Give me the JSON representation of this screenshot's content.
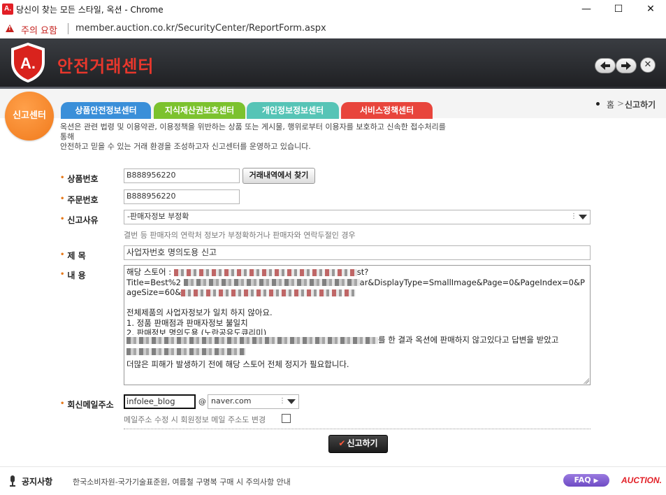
{
  "window": {
    "title": "당신이 찾는 모든 스타일, 옥션 - Chrome",
    "minimize": "—",
    "maximize": "☐",
    "close": "✕"
  },
  "address_bar": {
    "warning": "주의 요함",
    "url": "member.auction.co.kr/SecurityCenter/ReportForm.aspx"
  },
  "header": {
    "logo_text": "A.",
    "title": "안전거래센터",
    "close_label": "✕"
  },
  "badge": "신고센터",
  "tabs": [
    {
      "label": "상품안전정보센터",
      "color": "#3a8fd9"
    },
    {
      "label": "지식재산권보호센터",
      "color": "#7cc22e"
    },
    {
      "label": "개인정보정보센터",
      "color": "#56c4b6"
    },
    {
      "label": "서비스정책센터",
      "color": "#e8453c"
    }
  ],
  "breadcrumb": {
    "home": "홈",
    "sep": ">",
    "current": "신고하기"
  },
  "intro": {
    "line1": "옥션은 관련 법령 및 이용약관, 이용정책을 위반하는 상품 또는 게시물, 행위로부터 이용자를 보호하고 신속한 접수처리를 통해",
    "line2": "안전하고 믿을 수 있는 거래 환경을 조성하고자 신고센터를 운영하고 있습니다."
  },
  "form": {
    "product_no_label": "상품번호",
    "product_no_value": "B888956220",
    "find_button": "거래내역에서 찾기",
    "order_no_label": "주문번호",
    "order_no_value": "B888956220",
    "reason_label": "신고사유",
    "reason_value": "-판매자정보 부정확",
    "reason_help": "결번 등 판매자의 연락처 정보가 부정확하거나 판매자와 연락두절인 경우",
    "subject_label": "제    목",
    "subject_value": "사업자번호 명의도용 신고",
    "content_label": "내    용",
    "content": {
      "l1_start": "해당 스토어 :",
      "l1_end": "st?",
      "l2_start": "Title=Best%2",
      "l2_end": "ar&DisplayType=SmallImage&Page=0&PageIndex=0&P",
      "l3_start": "ageSize=60&",
      "l5": "전체제품의 사업자정보가 일치 하지 않아요.",
      "l6": "1. 정품 판매점과 판매자정보 불일치",
      "l7": "2. 판매정보 명의도용 (노란공유도큐리미)",
      "l8_end": "를 한 결과 옥션에 판매하지 않고있다고 답변을 받았고",
      "l10": "더많은 피해가 발생하기 전에 해당 스토어 전체 정지가 필요합니다."
    },
    "email_label": "회신메일주소",
    "email_user": "infolee_blog",
    "email_at": "@",
    "email_domain": "naver.com",
    "email_help": "메일주소 수정 시 회원정보 메일 주소도 변경",
    "submit_check": "✔",
    "submit": "신고하기"
  },
  "footer": {
    "notice_label": "공지사항",
    "notice_text": "한국소비자원-국가기술표준원, 여름철 구명복 구매 시 주의사항 안내",
    "faq": "FAQ",
    "faq_arrow": "▶",
    "logo": "AUCTION."
  }
}
